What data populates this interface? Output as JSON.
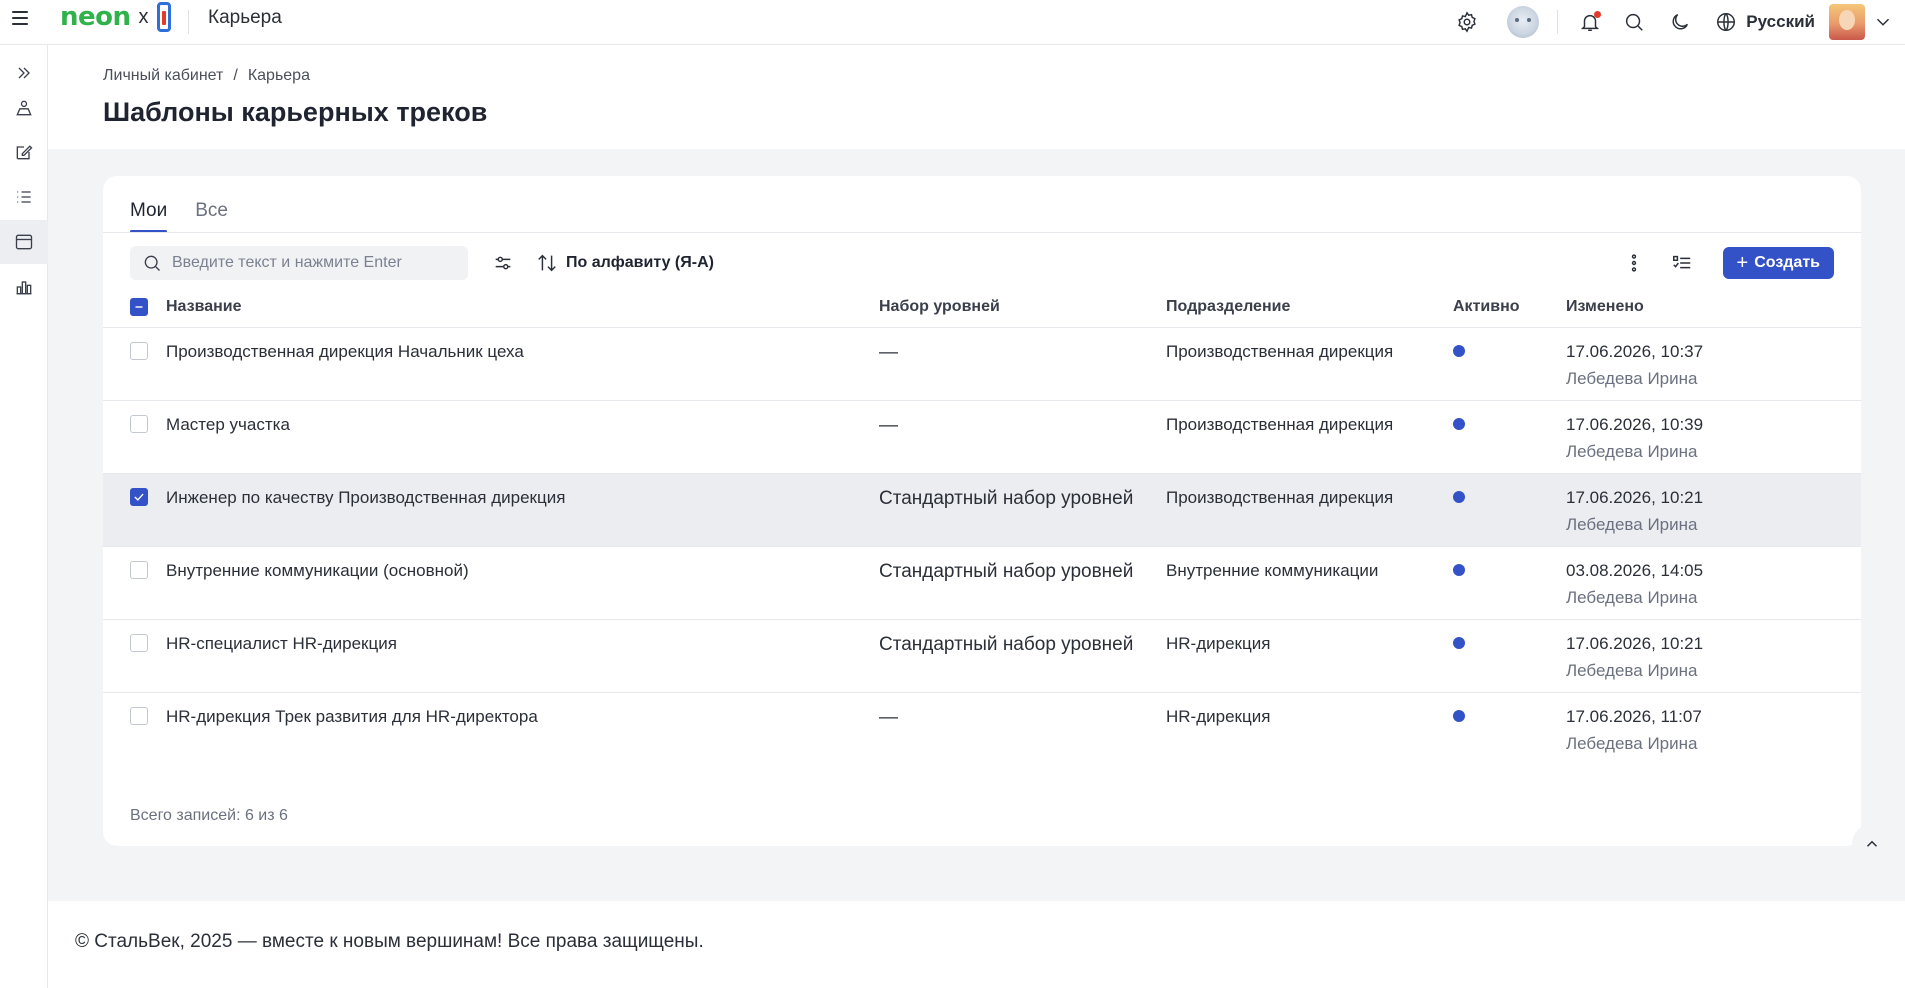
{
  "header": {
    "logo_text": "neon",
    "logo_separator": "x",
    "app_title": "Карьера",
    "language": "Русский"
  },
  "breadcrumb": {
    "items": [
      "Личный кабинет",
      "Карьера"
    ],
    "separator": "/"
  },
  "page": {
    "title": "Шаблоны карьерных треков"
  },
  "tabs": [
    {
      "label": "Мои",
      "active": true
    },
    {
      "label": "Все",
      "active": false
    }
  ],
  "toolbar": {
    "search_placeholder": "Введите текст и нажмите Enter",
    "sort_label": "По алфавиту (Я-А)",
    "create_label": "Создать"
  },
  "table": {
    "columns": [
      "Название",
      "Набор уровней",
      "Подразделение",
      "Активно",
      "Изменено"
    ],
    "rows": [
      {
        "name": "Производственная дирекция Начальник цеха",
        "level": "—",
        "dept": "Производственная дирекция",
        "active": true,
        "date": "17.06.2026, 10:37",
        "author": "Лебедева Ирина",
        "checked": false
      },
      {
        "name": "Мастер участка",
        "level": "—",
        "dept": "Производственная дирекция",
        "active": true,
        "date": "17.06.2026, 10:39",
        "author": "Лебедева Ирина",
        "checked": false
      },
      {
        "name": "Инженер по качеству Производственная дирекция",
        "level": "Стандартный набор уровней",
        "dept": "Производственная дирекция",
        "active": true,
        "date": "17.06.2026, 10:21",
        "author": "Лебедева Ирина",
        "checked": true
      },
      {
        "name": "Внутренние коммуникации (основной)",
        "level": "Стандартный набор уровней",
        "dept": "Внутренние коммуникации",
        "active": true,
        "date": "03.08.2026, 14:05",
        "author": "Лебедева Ирина",
        "checked": false
      },
      {
        "name": "HR-специалист HR-дирекция",
        "level": "Стандартный набор уровней",
        "dept": "HR-дирекция",
        "active": true,
        "date": "17.06.2026, 10:21",
        "author": "Лебедева Ирина",
        "checked": false
      },
      {
        "name": "HR-дирекция Трек развития для HR-директора",
        "level": "—",
        "dept": "HR-дирекция",
        "active": true,
        "date": "17.06.2026, 11:07",
        "author": "Лебедева Ирина",
        "checked": false
      }
    ],
    "total_text": "Всего записей: 6 из 6"
  },
  "footer": {
    "text": "© СтальВек, 2025 — вместе к новым вершинам! Все права защищены."
  },
  "colors": {
    "accent": "#3452c7",
    "brand_green": "#2fb24a",
    "selected_row": "#ecedf0"
  },
  "icons": {
    "top": [
      "settings-icon",
      "robot-assistant-icon",
      "bell-icon",
      "search-icon",
      "moon-icon",
      "globe-icon",
      "chevron-down-icon"
    ],
    "sidebar": [
      "expand-icon",
      "person-icon",
      "edit-icon",
      "list-icon",
      "window-icon",
      "chart-icon"
    ]
  }
}
